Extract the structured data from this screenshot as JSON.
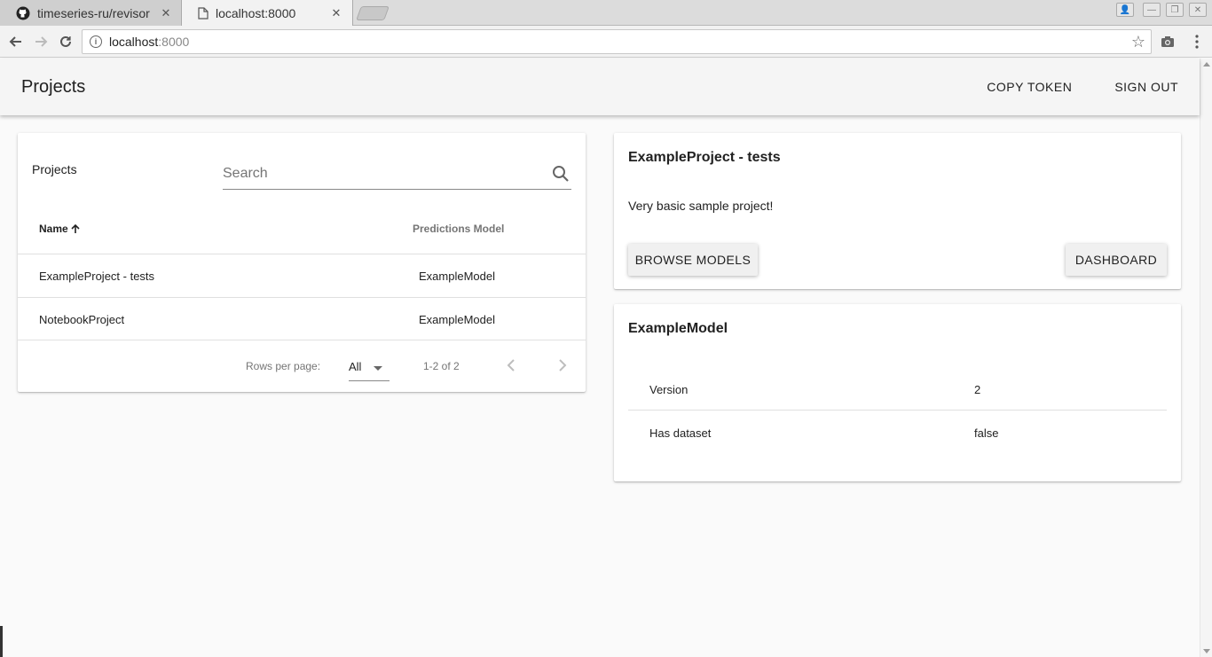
{
  "browser": {
    "tabs": [
      {
        "title": "timeseries-ru/revisor",
        "active": false,
        "icon": "github-icon"
      },
      {
        "title": "localhost:8000",
        "active": true,
        "icon": "page-icon"
      }
    ],
    "url_host": "localhost",
    "url_port": ":8000"
  },
  "appbar": {
    "title": "Projects",
    "copy_token_label": "COPY TOKEN",
    "sign_out_label": "SIGN OUT"
  },
  "projects_table": {
    "title": "Projects",
    "search_placeholder": "Search",
    "columns": {
      "name": "Name",
      "predictions_model": "Predictions Model"
    },
    "sort": {
      "column": "name",
      "direction": "ascending"
    },
    "rows": [
      {
        "name": "ExampleProject - tests",
        "model": "ExampleModel"
      },
      {
        "name": "NotebookProject",
        "model": "ExampleModel"
      }
    ],
    "pagination": {
      "rows_per_page_label": "Rows per page:",
      "rows_per_page_value": "All",
      "range": "1-2 of 2"
    }
  },
  "project_detail": {
    "title": "ExampleProject - tests",
    "description": "Very basic sample project!",
    "browse_models_label": "BROWSE MODELS",
    "dashboard_label": "DASHBOARD"
  },
  "model_detail": {
    "title": "ExampleModel",
    "fields": [
      {
        "key": "Version",
        "value": "2"
      },
      {
        "key": "Has dataset",
        "value": "false"
      }
    ]
  },
  "colors": {
    "background": "#fafafa",
    "appbar": "#f5f5f5",
    "card": "#ffffff",
    "text": "#212121",
    "muted": "#757575"
  }
}
